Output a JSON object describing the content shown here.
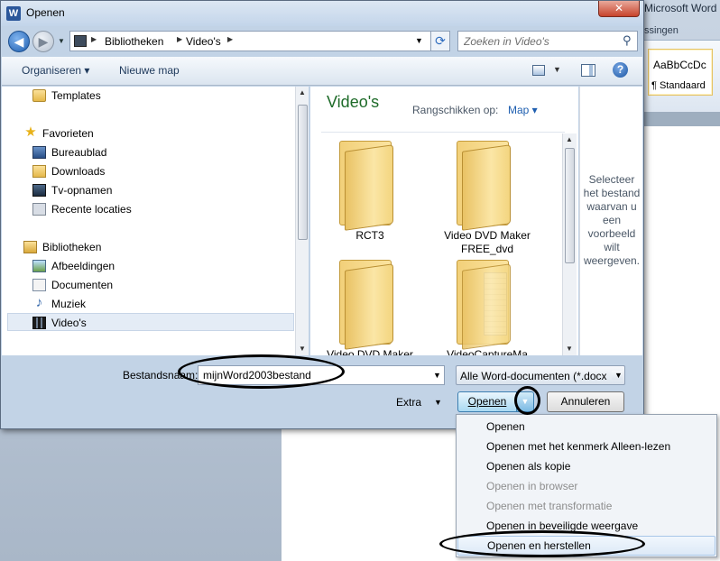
{
  "background_app": {
    "title": "Microsoft Word",
    "ribbon_tab_partial": "ssingen",
    "style_sample": "AaBbCcDc",
    "style_name": "¶ Standaard"
  },
  "dialog": {
    "app_icon": "W",
    "title": "Openen",
    "close": "✕"
  },
  "address": {
    "parts": [
      "Bibliotheken",
      "Video's"
    ],
    "search_placeholder": "Zoeken in Video's"
  },
  "toolbar": {
    "organize": "Organiseren ▾",
    "new_folder": "Nieuwe map",
    "help": "?"
  },
  "nav": {
    "templates": "Templates",
    "favorites_header": "Favorieten",
    "favorites": [
      "Bureaublad",
      "Downloads",
      "Tv-opnamen",
      "Recente locaties"
    ],
    "libraries_header": "Bibliotheken",
    "libraries": [
      "Afbeeldingen",
      "Documenten",
      "Muziek",
      "Video's"
    ]
  },
  "content": {
    "library_title": "Video's",
    "sort_label": "Rangschikken op:",
    "sort_value": "Map ▾",
    "folders": [
      "RCT3",
      "Video DVD Maker FREE_dvd",
      "Video DVD Maker",
      "VideoCaptureMa"
    ]
  },
  "preview": {
    "message": "Selecteer het bestand waarvan u een voorbeeld wilt weergeven."
  },
  "bottom": {
    "filename_label": "Bestandsnaam:",
    "filename_value": "mijnWord2003bestand",
    "filter": "Alle Word-documenten (*.docx",
    "extra": "Extra",
    "open": "Openen",
    "cancel": "Annuleren"
  },
  "open_menu": [
    {
      "label": "Openen",
      "enabled": true
    },
    {
      "label": "Openen met het kenmerk Alleen-lezen",
      "enabled": true
    },
    {
      "label": "Openen als kopie",
      "enabled": true
    },
    {
      "label": "Openen in browser",
      "enabled": false
    },
    {
      "label": "Openen met transformatie",
      "enabled": false
    },
    {
      "label": "Openen in beveiligde weergave",
      "enabled": true
    },
    {
      "label": "Openen en herstellen",
      "enabled": true
    }
  ],
  "icons": [
    "back-icon",
    "forward-icon",
    "refresh-icon",
    "search-icon",
    "view-icon",
    "preview-pane-icon",
    "help-icon",
    "folder-icon",
    "star-icon",
    "music-icon",
    "video-icon"
  ]
}
